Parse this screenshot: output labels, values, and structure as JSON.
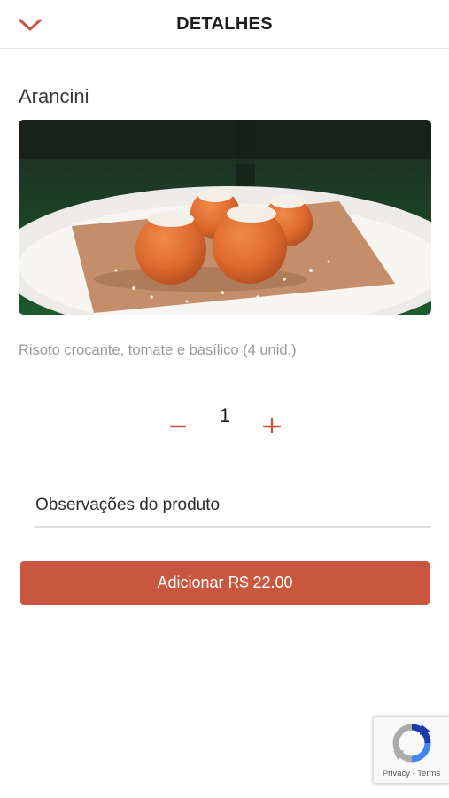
{
  "header": {
    "title": "DETALHES",
    "back_icon": "chevron-down-icon"
  },
  "product": {
    "name": "Arancini",
    "image_alt": "Arancini",
    "description": "Risoto crocante, tomate e basílico (4 unid.)"
  },
  "quantity": {
    "value": "1",
    "minus_icon": "minus-icon",
    "plus_icon": "plus-icon"
  },
  "notes": {
    "placeholder": "Observações do produto",
    "value": ""
  },
  "add_button": {
    "label": "Adicionar R$ 22.00"
  },
  "recaptcha": {
    "privacy": "Privacy",
    "separator": " - ",
    "terms": "Terms"
  },
  "colors": {
    "accent": "#c9573f",
    "text": "#2b2b2b",
    "muted": "#9a9a9a"
  }
}
